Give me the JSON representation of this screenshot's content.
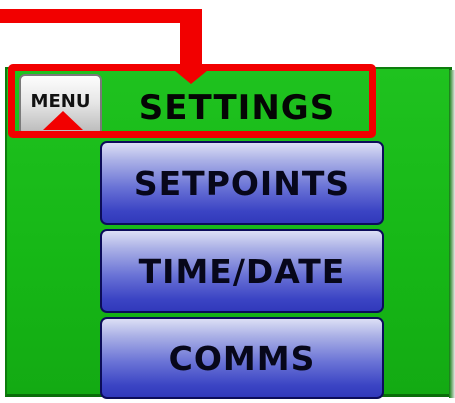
{
  "header": {
    "menu_label": "MENU",
    "title": "SETTINGS"
  },
  "nav": {
    "items": [
      {
        "label": "SETPOINTS"
      },
      {
        "label": "TIME/DATE"
      },
      {
        "label": "COMMS"
      }
    ]
  },
  "annotation": {
    "callout_color": "#f20000"
  },
  "colors": {
    "panel_green": "#16b716",
    "button_blue": "#3b44c4",
    "menu_gray": "#e7e7e7"
  }
}
